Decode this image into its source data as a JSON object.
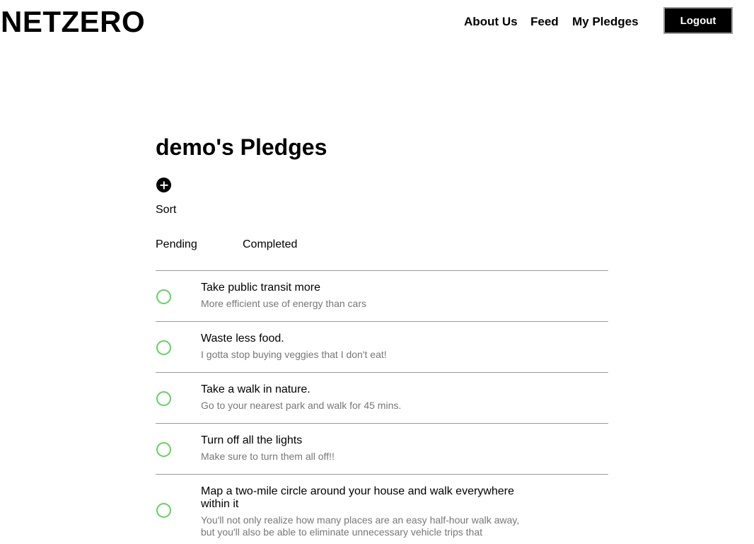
{
  "header": {
    "logo": "NETZERO",
    "nav": {
      "about": "About Us",
      "feed": "Feed",
      "pledges": "My Pledges"
    },
    "logout_label": "Logout"
  },
  "main": {
    "title": "demo's Pledges",
    "add_icon": "plus-circle-icon",
    "sort_label": "Sort",
    "tabs": {
      "pending": "Pending",
      "completed": "Completed"
    },
    "pledges": [
      {
        "title": "Take public transit more",
        "description": "More efficient use of energy than cars"
      },
      {
        "title": "Waste less food.",
        "description": "I gotta stop buying veggies that I don't eat!"
      },
      {
        "title": "Take a walk in nature.",
        "description": "Go to your nearest park and walk for 45 mins."
      },
      {
        "title": "Turn off all the lights",
        "description": "Make sure to turn them all off!!"
      },
      {
        "title": "Map a two-mile circle around your house and walk everywhere within it",
        "description": "You'll not only realize how many places are an easy half-hour walk away, but you'll also be able to eliminate unnecessary vehicle trips that"
      }
    ]
  },
  "colors": {
    "check_ring": "#5fd35f",
    "divider": "#9a9a9a",
    "muted_text": "#777777"
  }
}
